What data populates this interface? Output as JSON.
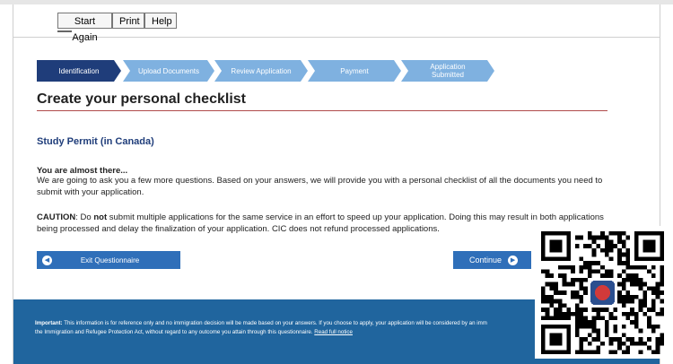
{
  "toolbar": {
    "start_again": "Start Again",
    "print": "Print",
    "help": "Help"
  },
  "steps": [
    {
      "label": "Identification",
      "active": true
    },
    {
      "label": "Upload Documents",
      "active": false
    },
    {
      "label": "Review Application",
      "active": false
    },
    {
      "label": "Payment",
      "active": false
    },
    {
      "label": "Application\nSubmitted",
      "active": false
    }
  ],
  "main": {
    "title": "Create your personal checklist",
    "subtitle": "Study Permit (in Canada)",
    "almost_heading": "You are almost there...",
    "almost_text": "We are going to ask you a few more questions. Based on your answers, we will provide you with a personal checklist of all the documents you need to submit with your application.",
    "caution_label": "CAUTION",
    "caution_pre": ": Do ",
    "caution_not": "not",
    "caution_text": " submit multiple applications for the same service in an effort to speed up your application.  Doing this may result in both applications being processed and delay the finalization of your application. CIC does not refund processed applications."
  },
  "buttons": {
    "exit": "Exit Questionnaire",
    "continue": "Continue"
  },
  "footer": {
    "important_label": "Important:",
    "text": " This information is for reference only and no immigration decision will be made based on your answers. If you choose to apply, your application will be considered by an imm",
    "text2": "the Immigration and Refugee Protection Act, without regard to any outcome you attain through this questionnaire.",
    "link": "Read full notice"
  },
  "colors": {
    "active_step": "#1f3d7a",
    "inactive_step": "#7fb1e0",
    "button": "#2f6fb9",
    "footer": "#20659e",
    "title_rule": "#b04a4a"
  }
}
